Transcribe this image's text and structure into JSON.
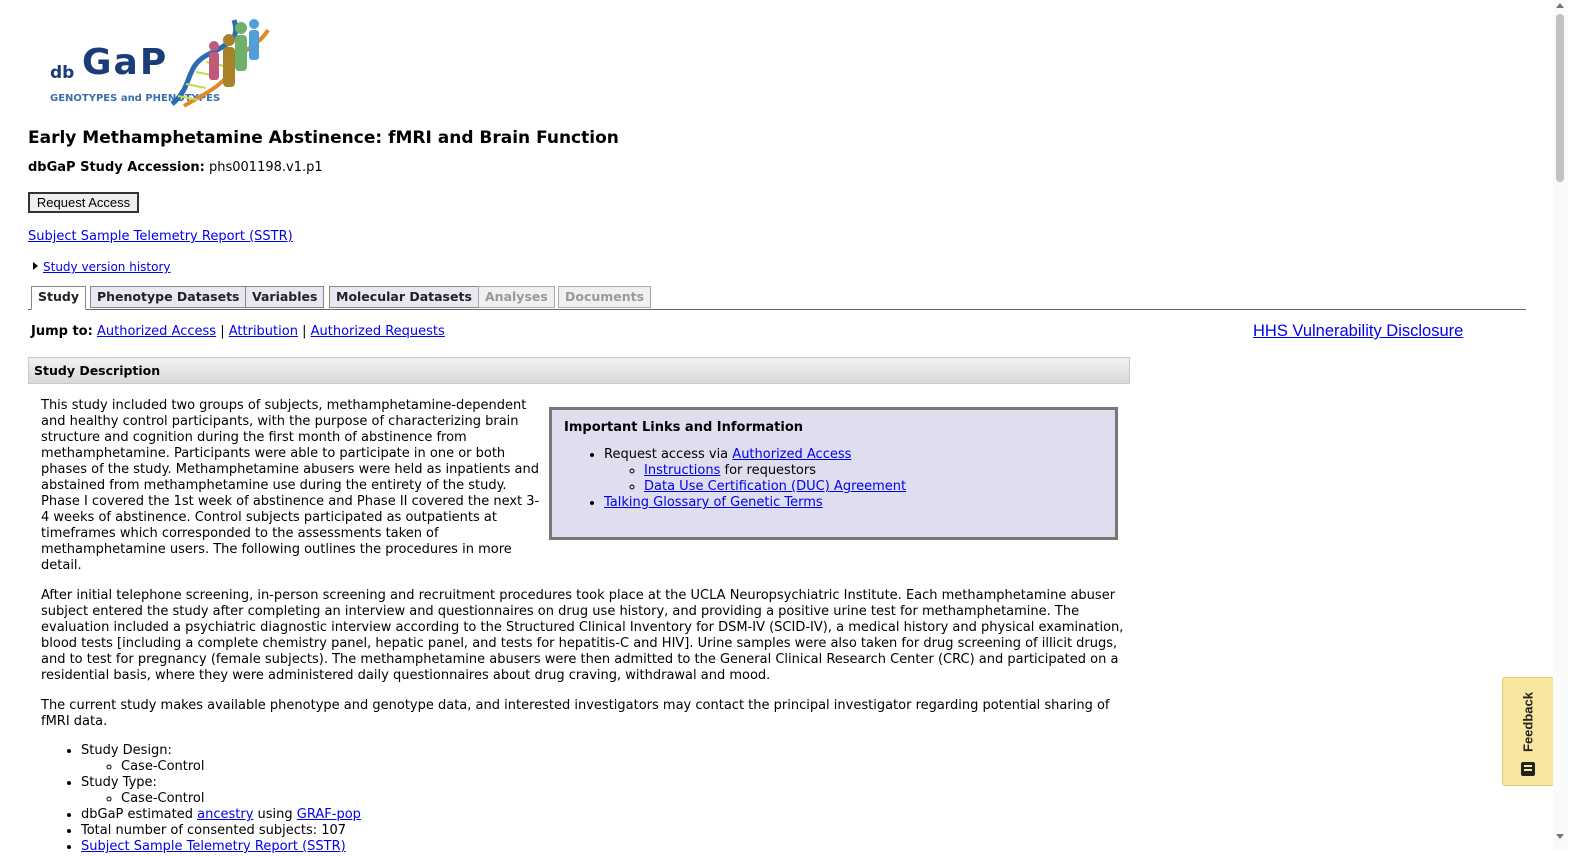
{
  "logo": {
    "db": "db",
    "gap": "GaP",
    "subtitle": "GENOTYPES and PHENOTYPES",
    "colors": {
      "primary": "#1a3c78",
      "accent": "#3a6fb0"
    }
  },
  "study": {
    "title": "Early Methamphetamine Abstinence: fMRI and Brain Function",
    "accession_label": "dbGaP Study Accession:",
    "accession_value": "phs001198.v1.p1"
  },
  "actions": {
    "request_access": "Request Access",
    "sstr_link": "Subject Sample Telemetry Report (SSTR)",
    "version_history": "Study version history"
  },
  "tabs": [
    {
      "label": "Study",
      "state": "active"
    },
    {
      "label": "Phenotype Datasets",
      "state": "enabled"
    },
    {
      "label": "Variables",
      "state": "enabled"
    },
    {
      "label": "Molecular Datasets",
      "state": "enabled"
    },
    {
      "label": "Analyses",
      "state": "disabled"
    },
    {
      "label": "Documents",
      "state": "disabled"
    }
  ],
  "jump": {
    "label": "Jump to:",
    "links": [
      "Authorized Access",
      "Attribution",
      "Authorized Requests"
    ],
    "separator": "|"
  },
  "hhs_link": "HHS Vulnerability Disclosure",
  "section": {
    "heading": "Study Description",
    "paragraphs": [
      "This study included two groups of subjects, methamphetamine-dependent and healthy control participants, with the purpose of characterizing brain structure and cognition during the first month of abstinence from methamphetamine. Participants were able to participate in one or both phases of the study. Methamphetamine abusers were held as inpatients and abstained from methamphetamine use during the entirety of the study. Phase I covered the 1st week of abstinence and Phase II covered the next 3-4 weeks of abstinence. Control subjects participated as outpatients at timeframes which corresponded to the assessments taken of methamphetamine users. The following outlines the procedures in more detail.",
      "After initial telephone screening, in-person screening and recruitment procedures took place at the UCLA Neuropsychiatric Institute. Each methamphetamine abuser subject entered the study after completing an interview and questionnaires on drug use history, and providing a positive urine test for methamphetamine. The evaluation included a psychiatric diagnostic interview according to the Structured Clinical Inventory for DSM-IV (SCID-IV), a medical history and physical examination, blood tests [including a complete chemistry panel, hepatic panel, and tests for hepatitis-C and HIV]. Urine samples were also taken for drug screening of illicit drugs, and to test for pregnancy (female subjects). The methamphetamine abusers were then admitted to the General Clinical Research Center (CRC) and participated on a residential basis, where they were administered daily questionnaires about drug craving, withdrawal and mood.",
      "The current study makes available phenotype and genotype data, and interested investigators may contact the principal investigator regarding potential sharing of fMRI data."
    ]
  },
  "infobox": {
    "heading": "Important Links and Information",
    "request_prefix": "Request access via",
    "authorized_access": "Authorized Access",
    "instructions": "Instructions",
    "instructions_suffix": "for requestors",
    "duc": "Data Use Certification (DUC) Agreement",
    "glossary": "Talking Glossary of Genetic Terms"
  },
  "facts": {
    "design_label": "Study Design:",
    "design_value": "Case-Control",
    "type_label": "Study Type:",
    "type_value": "Case-Control",
    "ancestry_prefix": "dbGaP estimated",
    "ancestry_link": "ancestry",
    "ancestry_mid": "using",
    "grafpop_link": "GRAF-pop",
    "subjects": "Total number of consented subjects: 107",
    "sstr": "Subject Sample Telemetry Report (SSTR)"
  },
  "feedback": {
    "label": "Feedback",
    "color": "#f9e79f"
  }
}
